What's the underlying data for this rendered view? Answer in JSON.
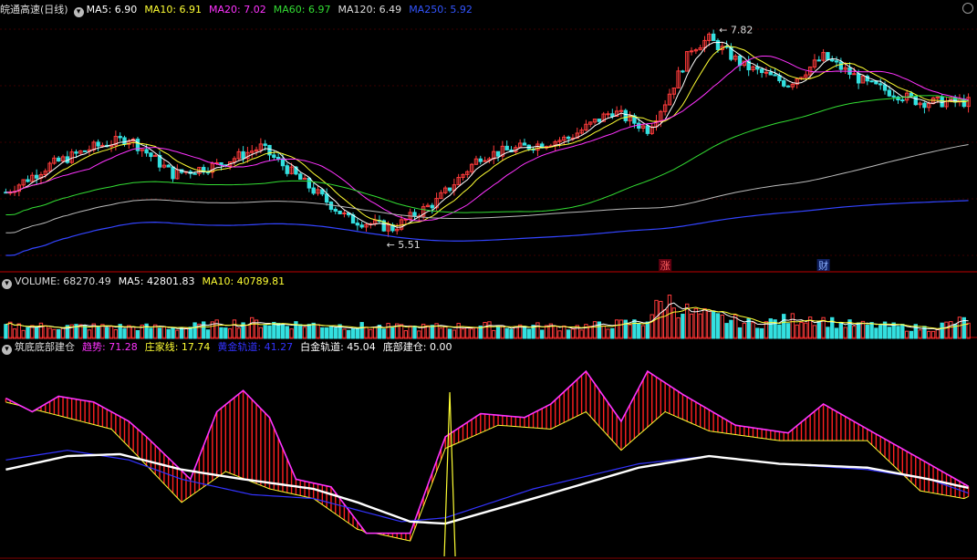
{
  "window": {
    "title": "皖通高速(日线)"
  },
  "colors": {
    "up": "#ff3b3b",
    "down": "#33e0e0",
    "ma5": "#ffffff",
    "ma10": "#ffff33",
    "ma20": "#ff33ff",
    "ma60": "#33dd33",
    "ma120": "#bbbbbb",
    "ma250": "#3344ff",
    "grid": "#800000",
    "trend": "#ff33ff",
    "zhuang": "#ffff33",
    "huangjin": "#3333ff",
    "baijin": "#ffffff"
  },
  "price_panel": {
    "legend": [
      {
        "label": "MA5: 6.90",
        "color": "#ffffff"
      },
      {
        "label": "MA10: 6.91",
        "color": "#ffff33"
      },
      {
        "label": "MA20: 7.02",
        "color": "#ff33ff"
      },
      {
        "label": "MA60: 6.97",
        "color": "#33dd33"
      },
      {
        "label": "MA120: 6.49",
        "color": "#dddddd"
      },
      {
        "label": "MA250: 5.92",
        "color": "#3355ff"
      }
    ],
    "high_label": "7.82",
    "low_label": "5.51",
    "badges": [
      {
        "text": "涨",
        "kind": "up"
      },
      {
        "text": "财",
        "kind": "info"
      }
    ]
  },
  "volume_panel": {
    "title": "VOLUME: 68270.49",
    "legend": [
      {
        "label": "MA5: 42801.83",
        "color": "#ffffff"
      },
      {
        "label": "MA10: 40789.81",
        "color": "#ffff33"
      }
    ]
  },
  "indicator_panel": {
    "title": "筑底底部建仓",
    "legend": [
      {
        "label": "趋势: 71.28",
        "color": "#ff33ff"
      },
      {
        "label": "庄家线: 17.74",
        "color": "#ffff33"
      },
      {
        "label": "黄金轨道: 41.27",
        "color": "#3333ff"
      },
      {
        "label": "白金轨道: 45.04",
        "color": "#ffffff"
      },
      {
        "label": "底部建仓: 0.00",
        "color": "#ffffff"
      }
    ]
  },
  "chart_data": {
    "type": "candlestick",
    "price_anchors": [
      [
        0,
        6.0
      ],
      [
        10,
        6.3
      ],
      [
        20,
        6.5
      ],
      [
        28,
        6.6
      ],
      [
        38,
        6.2
      ],
      [
        48,
        6.3
      ],
      [
        58,
        6.5
      ],
      [
        68,
        6.1
      ],
      [
        78,
        5.7
      ],
      [
        88,
        5.6
      ],
      [
        98,
        5.9
      ],
      [
        108,
        6.4
      ],
      [
        118,
        6.5
      ],
      [
        128,
        6.6
      ],
      [
        138,
        6.9
      ],
      [
        146,
        6.7
      ],
      [
        150,
        7.0
      ],
      [
        156,
        7.6
      ],
      [
        160,
        7.7
      ],
      [
        168,
        7.4
      ],
      [
        178,
        7.2
      ],
      [
        186,
        7.5
      ],
      [
        196,
        7.2
      ],
      [
        208,
        7.0
      ],
      [
        220,
        7.0
      ]
    ],
    "price_ylim": [
      5.4,
      7.95
    ],
    "volume_anchors": [
      [
        0,
        35
      ],
      [
        40,
        30
      ],
      [
        54,
        45
      ],
      [
        60,
        42
      ],
      [
        90,
        30
      ],
      [
        110,
        35
      ],
      [
        130,
        32
      ],
      [
        145,
        45
      ],
      [
        150,
        110
      ],
      [
        156,
        70
      ],
      [
        170,
        40
      ],
      [
        183,
        60
      ],
      [
        190,
        40
      ],
      [
        210,
        28
      ],
      [
        220,
        55
      ]
    ],
    "volume_ylim": [
      0,
      130
    ],
    "trend_anchors": [
      [
        0,
        82
      ],
      [
        6,
        75
      ],
      [
        12,
        83
      ],
      [
        20,
        80
      ],
      [
        28,
        70
      ],
      [
        32,
        62
      ],
      [
        42,
        40
      ],
      [
        48,
        75
      ],
      [
        54,
        86
      ],
      [
        60,
        72
      ],
      [
        66,
        40
      ],
      [
        74,
        36
      ],
      [
        82,
        12
      ],
      [
        92,
        12
      ],
      [
        100,
        62
      ],
      [
        108,
        74
      ],
      [
        118,
        72
      ],
      [
        124,
        79
      ],
      [
        132,
        96
      ],
      [
        140,
        70
      ],
      [
        146,
        96
      ],
      [
        154,
        84
      ],
      [
        166,
        68
      ],
      [
        178,
        64
      ],
      [
        186,
        79
      ],
      [
        196,
        66
      ],
      [
        210,
        48
      ],
      [
        220,
        35
      ],
      [
        220,
        51
      ]
    ],
    "zhuang_anchors": [
      [
        0,
        80
      ],
      [
        24,
        66
      ],
      [
        30,
        52
      ],
      [
        40,
        28
      ],
      [
        50,
        44
      ],
      [
        60,
        35
      ],
      [
        70,
        30
      ],
      [
        80,
        14
      ],
      [
        92,
        8
      ],
      [
        100,
        56
      ],
      [
        112,
        68
      ],
      [
        124,
        66
      ],
      [
        132,
        75
      ],
      [
        140,
        55
      ],
      [
        150,
        75
      ],
      [
        160,
        65
      ],
      [
        176,
        60
      ],
      [
        196,
        60
      ],
      [
        208,
        34
      ],
      [
        218,
        30
      ],
      [
        220,
        32
      ]
    ],
    "huangjin_anchors": [
      [
        0,
        50
      ],
      [
        14,
        55
      ],
      [
        28,
        50
      ],
      [
        40,
        40
      ],
      [
        56,
        32
      ],
      [
        70,
        30
      ],
      [
        80,
        24
      ],
      [
        90,
        18
      ],
      [
        100,
        20
      ],
      [
        120,
        35
      ],
      [
        144,
        48
      ],
      [
        160,
        52
      ],
      [
        176,
        48
      ],
      [
        196,
        45
      ],
      [
        210,
        40
      ],
      [
        220,
        32
      ]
    ],
    "baijin_anchors": [
      [
        0,
        45
      ],
      [
        14,
        52
      ],
      [
        26,
        53
      ],
      [
        40,
        45
      ],
      [
        54,
        40
      ],
      [
        70,
        35
      ],
      [
        80,
        28
      ],
      [
        92,
        18
      ],
      [
        100,
        17
      ],
      [
        120,
        30
      ],
      [
        144,
        46
      ],
      [
        160,
        52
      ],
      [
        176,
        48
      ],
      [
        196,
        46
      ],
      [
        210,
        40
      ],
      [
        220,
        35
      ]
    ],
    "bottom_signal_bar": 101,
    "indicator_ylim": [
      0,
      105
    ],
    "bars": 220
  }
}
